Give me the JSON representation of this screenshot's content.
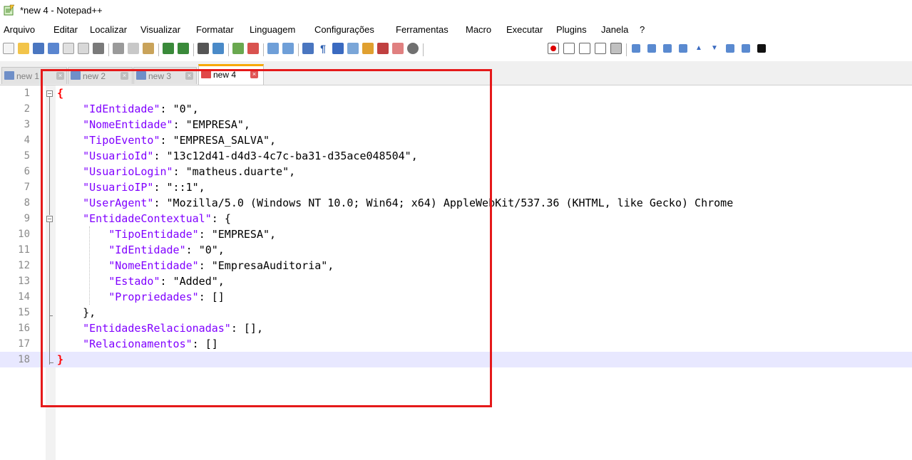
{
  "window": {
    "title": "*new 4 - Notepad++"
  },
  "menu": [
    "Arquivo",
    "Editar",
    "Localizar",
    "Visualizar",
    "Formatar",
    "Linguagem",
    "Configurações",
    "Ferramentas",
    "Macro",
    "Executar",
    "Plugins",
    "Janela",
    "?"
  ],
  "tabs": [
    {
      "label": "new 1",
      "active": false
    },
    {
      "label": "new 2",
      "active": false
    },
    {
      "label": "new 3",
      "active": false
    },
    {
      "label": "new 4",
      "active": true
    }
  ],
  "editor": {
    "line_numbers": [
      "1",
      "2",
      "3",
      "4",
      "5",
      "6",
      "7",
      "8",
      "9",
      "10",
      "11",
      "12",
      "13",
      "14",
      "15",
      "16",
      "17",
      "18"
    ],
    "current_line": 18,
    "lines": [
      {
        "indent": "",
        "key": "",
        "sep": "",
        "text": "{"
      },
      {
        "indent": "    ",
        "key": "\"IdEntidade\"",
        "sep": ": ",
        "text": "\"0\","
      },
      {
        "indent": "    ",
        "key": "\"NomeEntidade\"",
        "sep": ": ",
        "text": "\"EMPRESA\","
      },
      {
        "indent": "    ",
        "key": "\"TipoEvento\"",
        "sep": ": ",
        "text": "\"EMPRESA_SALVA\","
      },
      {
        "indent": "    ",
        "key": "\"UsuarioId\"",
        "sep": ": ",
        "text": "\"13c12d41-d4d3-4c7c-ba31-d35ace048504\","
      },
      {
        "indent": "    ",
        "key": "\"UsuarioLogin\"",
        "sep": ": ",
        "text": "\"matheus.duarte\","
      },
      {
        "indent": "    ",
        "key": "\"UsuarioIP\"",
        "sep": ": ",
        "text": "\"::1\","
      },
      {
        "indent": "    ",
        "key": "\"UserAgent\"",
        "sep": ": ",
        "text": "\"Mozilla/5.0 (Windows NT 10.0; Win64; x64) AppleWebKit/537.36 (KHTML, like Gecko) Chrome"
      },
      {
        "indent": "    ",
        "key": "\"EntidadeContextual\"",
        "sep": ": ",
        "text": "{"
      },
      {
        "indent": "        ",
        "key": "\"TipoEntidade\"",
        "sep": ": ",
        "text": "\"EMPRESA\","
      },
      {
        "indent": "        ",
        "key": "\"IdEntidade\"",
        "sep": ": ",
        "text": "\"0\","
      },
      {
        "indent": "        ",
        "key": "\"NomeEntidade\"",
        "sep": ": ",
        "text": "\"EmpresaAuditoria\","
      },
      {
        "indent": "        ",
        "key": "\"Estado\"",
        "sep": ": ",
        "text": "\"Added\","
      },
      {
        "indent": "        ",
        "key": "\"Propriedades\"",
        "sep": ": ",
        "text": "[]"
      },
      {
        "indent": "    ",
        "key": "",
        "sep": "",
        "text": "},"
      },
      {
        "indent": "    ",
        "key": "\"EntidadesRelacionadas\"",
        "sep": ": ",
        "text": "[],"
      },
      {
        "indent": "    ",
        "key": "\"Relacionamentos\"",
        "sep": ": ",
        "text": "[]"
      },
      {
        "indent": "",
        "key": "",
        "sep": "",
        "text": "}"
      }
    ]
  },
  "colors": {
    "json_key": "#8000ff",
    "brace_highlight": "#ff0000",
    "annotation_box": "#e5191a",
    "active_tab_accent": "#f7a800"
  }
}
